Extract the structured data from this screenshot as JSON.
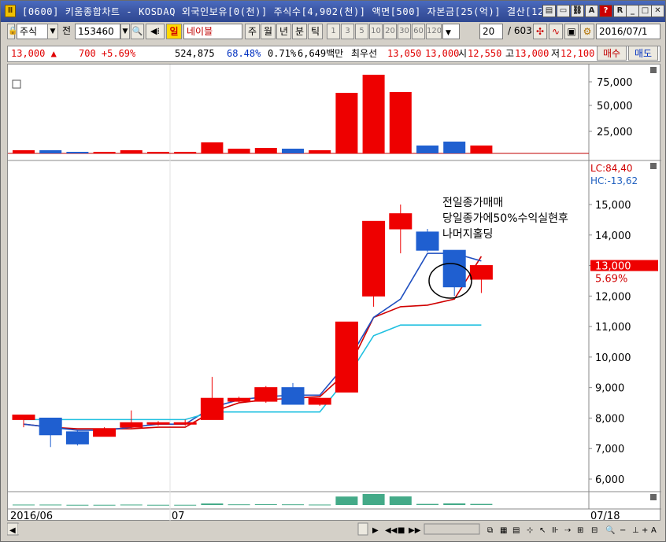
{
  "window": {
    "title": "[0600] 키움종합차트 - KOSDAQ 외국인보유[0(천)] 주식수[4,902(천)] 액면[500] 자본금[25(억)] 결산[12"
  },
  "toolbar": {
    "market": "주식",
    "prev_label": "전",
    "code": "153460",
    "period_selected": "일",
    "company": "네이블",
    "periods": [
      "일",
      "주",
      "월",
      "년",
      "분",
      "틱"
    ],
    "minute_options": [
      "1",
      "3",
      "5",
      "10",
      "20",
      "30",
      "60",
      "120"
    ],
    "count": "20",
    "total": "/ 603",
    "date": "2016/07/1"
  },
  "quote": {
    "price": "13,000 ▲",
    "change": "700 +5.69%",
    "volume": "524,875",
    "ratio": "68.48%",
    "turnover": "0.71%",
    "amount": "6,649백만",
    "best_bid_label": "최우선",
    "bid": "13,050",
    "ask": "13,000",
    "open_label": "시",
    "open": "12,550",
    "high_label": "고",
    "high": "13,000",
    "low_label": "저",
    "low": "12,100",
    "buy_label": "매수",
    "sell_label": "매도"
  },
  "chart_data": {
    "type": "candlestick",
    "title": "",
    "candles": [
      {
        "open": 7950,
        "close": 8100,
        "high": 8100,
        "low": 7700
      },
      {
        "open": 8000,
        "close": 7450,
        "high": 8000,
        "low": 7050
      },
      {
        "open": 7550,
        "close": 7150,
        "high": 7600,
        "low": 7100
      },
      {
        "open": 7400,
        "close": 7650,
        "high": 7700,
        "low": 7400
      },
      {
        "open": 7700,
        "close": 7850,
        "high": 8250,
        "low": 7650
      },
      {
        "open": 7800,
        "close": 7850,
        "high": 7900,
        "low": 7750
      },
      {
        "open": 7800,
        "close": 7850,
        "high": 7950,
        "low": 7750
      },
      {
        "open": 7950,
        "close": 8650,
        "high": 9350,
        "low": 7950
      },
      {
        "open": 8550,
        "close": 8650,
        "high": 8700,
        "low": 8500
      },
      {
        "open": 8550,
        "close": 9000,
        "high": 9050,
        "low": 8500
      },
      {
        "open": 9000,
        "close": 8450,
        "high": 9150,
        "low": 8450
      },
      {
        "open": 8450,
        "close": 8650,
        "high": 8650,
        "low": 8400
      },
      {
        "open": 8850,
        "close": 11150,
        "high": 11150,
        "low": 8850
      },
      {
        "open": 12000,
        "close": 14450,
        "high": 14450,
        "low": 11650
      },
      {
        "open": 14200,
        "close": 14700,
        "high": 15000,
        "low": 13400
      },
      {
        "open": 14100,
        "close": 13500,
        "high": 14200,
        "low": 13450
      },
      {
        "open": 13500,
        "close": 12300,
        "high": 13500,
        "low": 12000
      },
      {
        "open": 12550,
        "close": 13000,
        "high": 13000,
        "low": 12100
      }
    ],
    "ma_lines": [
      {
        "color": "#d00000",
        "values": [
          7800,
          7700,
          7650,
          7650,
          7650,
          7700,
          7700,
          8200,
          8500,
          8600,
          8650,
          8700,
          9500,
          11300,
          11650,
          11700,
          11900,
          13300
        ]
      },
      {
        "color": "#2050c0",
        "values": [
          7800,
          7700,
          7600,
          7600,
          7700,
          7800,
          7800,
          8350,
          8600,
          8700,
          8750,
          8750,
          9800,
          11300,
          11900,
          13400,
          13400,
          13150
        ]
      },
      {
        "color": "#20c0e0",
        "values": [
          7950,
          7950,
          7950,
          7950,
          7950,
          7950,
          7950,
          8200,
          8200,
          8200,
          8200,
          8200,
          9300,
          10700,
          11050,
          11050,
          11050,
          11050
        ]
      }
    ],
    "volume": [
      0.04,
      0.04,
      0.02,
      0.02,
      0.04,
      0.02,
      0.02,
      0.14,
      0.06,
      0.07,
      0.06,
      0.04,
      0.77,
      1.0,
      0.78,
      0.1,
      0.15,
      0.1
    ],
    "y_ticks": [
      "15,000",
      "14,000",
      "13,000",
      "12,000",
      "11,000",
      "10,000",
      "9,000",
      "8,000",
      "7,000",
      "6,000"
    ],
    "y_range": [
      5700,
      16500
    ],
    "volume_ticks": [
      "75,000",
      "50,000",
      "25,000"
    ],
    "x_labels": [
      "2016/06",
      "07",
      "07/18"
    ],
    "lc": "LC:84,40",
    "hc": "HC:-13,62",
    "last_price": "13,000",
    "last_change": "5.69%",
    "annotation": [
      "전일종가매매",
      "당일종가에50%수익실현후",
      "나머지홀딩"
    ]
  }
}
